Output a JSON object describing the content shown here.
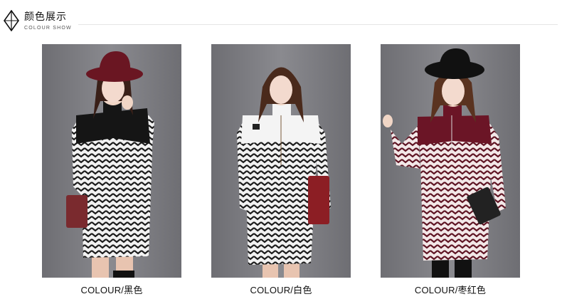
{
  "header": {
    "title_zh": "颜色展示",
    "title_en": "COLOUR SHOW"
  },
  "products": [
    {
      "caption": "COLOUR/黑色",
      "top_color": "#151515",
      "hat_color": "#6a1622",
      "bag_color": "#7a2a2e"
    },
    {
      "caption": "COLOUR/白色",
      "top_color": "#f4f4f4",
      "hat_color": "",
      "bag_color": "#8c1e24"
    },
    {
      "caption": "COLOUR/枣红色",
      "top_color": "#6b1526",
      "hat_color": "#111111",
      "bag_color": "#222222"
    }
  ],
  "colors": {
    "background": "#ffffff",
    "photo_bg": "#7b7b80",
    "zigzag_dark": "#1a1a1a",
    "zigzag_light": "#f2f2f2"
  }
}
